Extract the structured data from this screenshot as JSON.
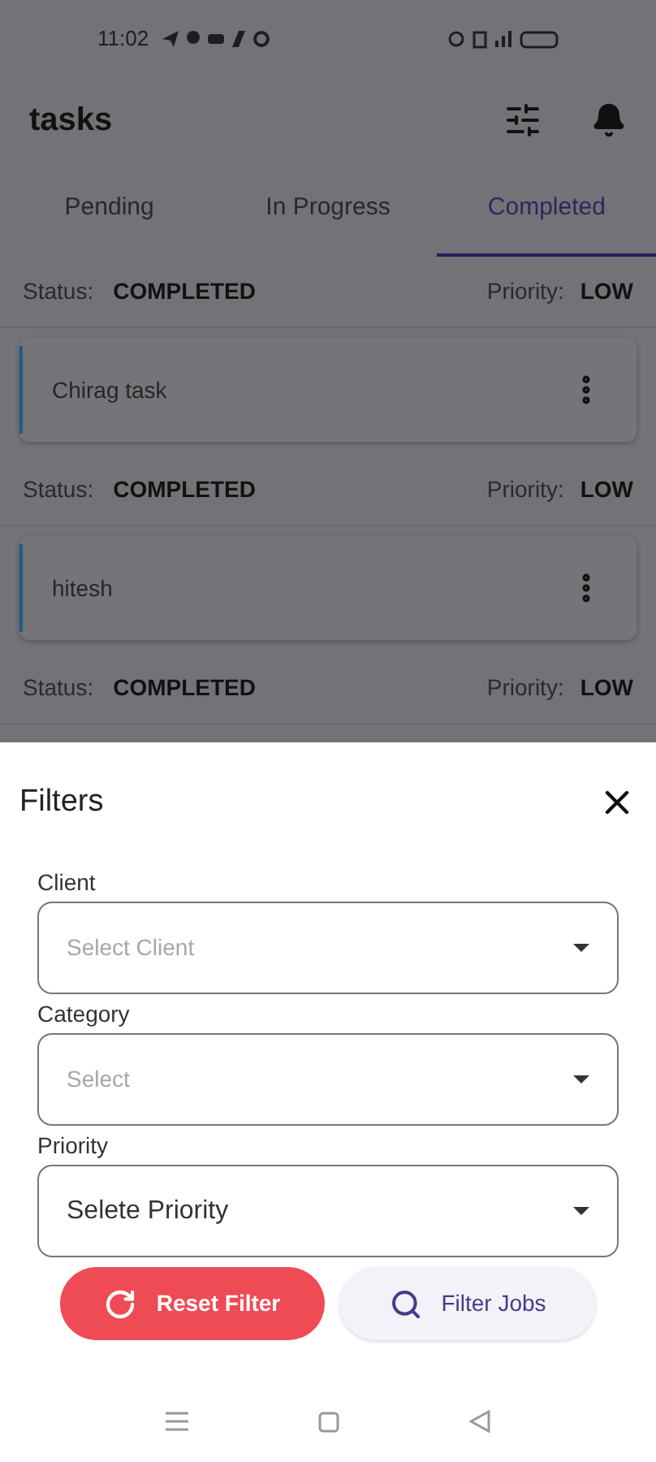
{
  "status_bar": {
    "time": "11:02"
  },
  "app_bar": {
    "title": "tasks"
  },
  "tabs": [
    {
      "label": "Pending",
      "selected": false
    },
    {
      "label": "In Progress",
      "selected": false
    },
    {
      "label": "Completed",
      "selected": true
    }
  ],
  "tasks": [
    {
      "status_label": "Status:",
      "status": "COMPLETED",
      "priority_label": "Priority:",
      "priority": "LOW",
      "name": "Chirag task"
    },
    {
      "status_label": "Status:",
      "status": "COMPLETED",
      "priority_label": "Priority:",
      "priority": "LOW",
      "name": "hitesh"
    },
    {
      "status_label": "Status:",
      "status": "COMPLETED",
      "priority_label": "Priority:",
      "priority": "LOW"
    }
  ],
  "filters": {
    "title": "Filters",
    "fields": [
      {
        "label": "Client",
        "placeholder": "Select Client"
      },
      {
        "label": "Category",
        "placeholder": "Select"
      },
      {
        "label": "Priority",
        "value": "Selete Priority"
      }
    ],
    "buttons": [
      {
        "kind": "reset",
        "label": "Reset Filter"
      },
      {
        "kind": "filter",
        "label": "Filter Jobs"
      }
    ]
  }
}
